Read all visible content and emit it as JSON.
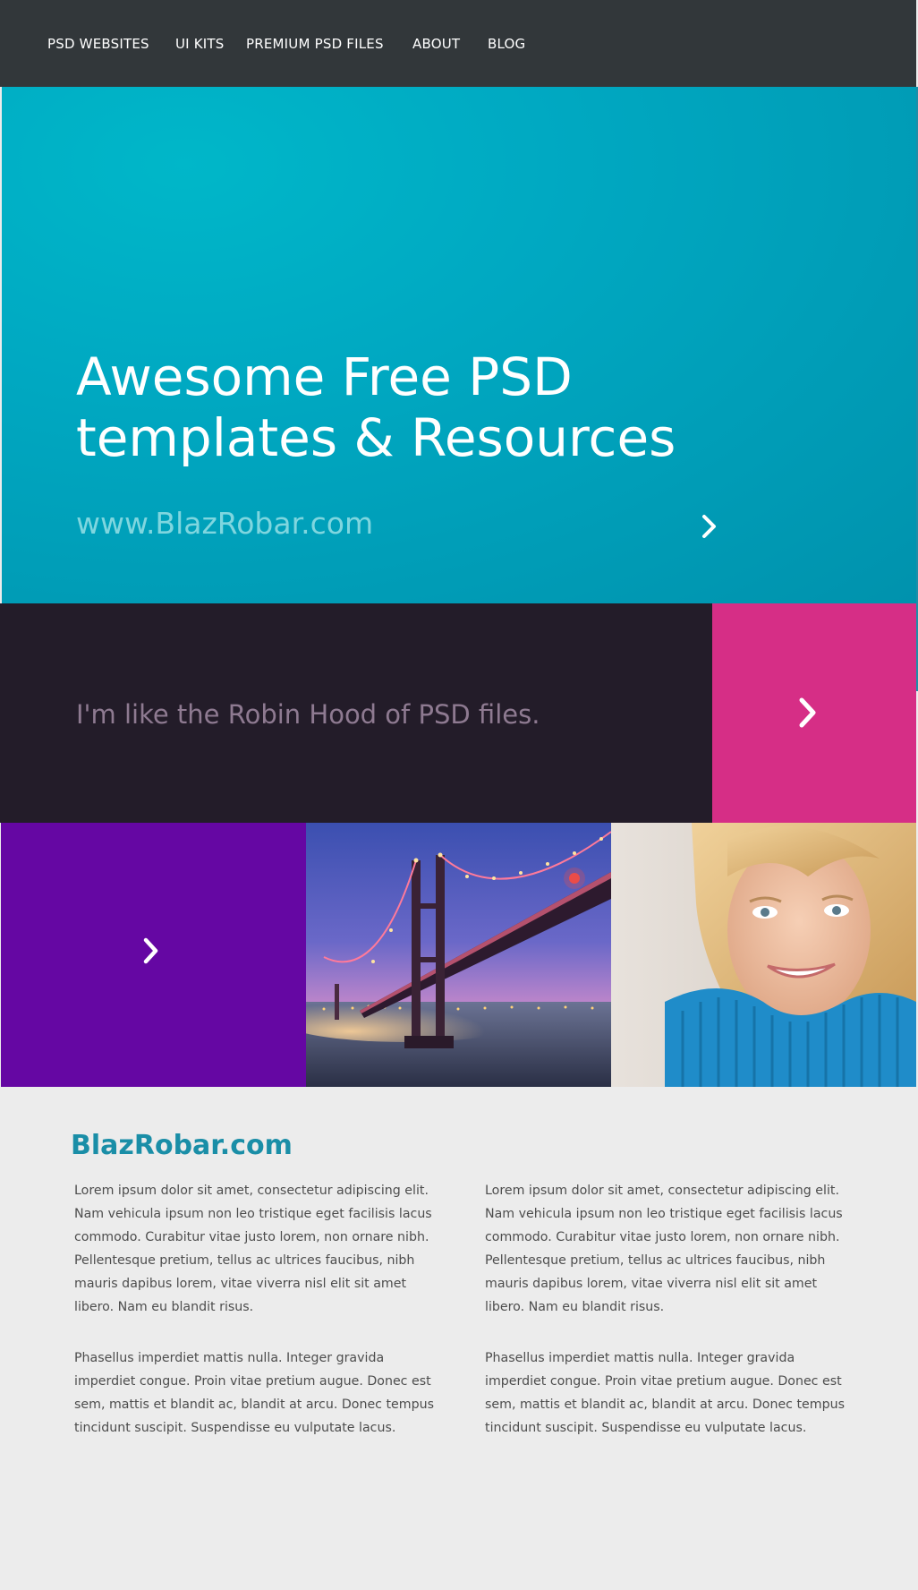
{
  "nav": {
    "items": [
      {
        "label": "PSD WEBSITES"
      },
      {
        "label": "UI KITS"
      },
      {
        "label": "PREMIUM PSD FILES"
      },
      {
        "label": "ABOUT"
      },
      {
        "label": "BLOG"
      }
    ]
  },
  "hero": {
    "title_line1": "Awesome Free PSD",
    "title_line2": "templates & Resources",
    "url": "www.BlazRobar.com",
    "arrow_icon": "chevron-right-icon"
  },
  "band": {
    "text": "I'm like the Robin Hood of PSD files.",
    "arrow_icon": "chevron-right-icon"
  },
  "tiles": {
    "purple_arrow_icon": "chevron-right-icon",
    "bridge_image": "bridge-photo",
    "woman_image": "woman-portrait-photo"
  },
  "content": {
    "title": "BlazRobar.com",
    "left": {
      "p1": "Lorem ipsum dolor sit amet, consectetur adipiscing elit. Nam vehicula ipsum non leo tristique eget facilisis lacus commodo. Curabitur vitae justo lorem, non ornare nibh. Pellentesque pretium, tellus ac ultrices faucibus, nibh mauris dapibus lorem, vitae viverra nisl elit sit amet libero. Nam eu blandit risus.",
      "p2": "Phasellus imperdiet mattis nulla. Integer gravida imperdiet congue. Proin vitae pretium augue. Donec est sem, mattis et blandit ac, blandit at arcu. Donec tempus tincidunt suscipit. Suspendisse eu vulputate lacus."
    },
    "right": {
      "p1": "Lorem ipsum dolor sit amet, consectetur adipiscing elit. Nam vehicula ipsum non leo tristique eget facilisis lacus commodo. Curabitur vitae justo lorem, non ornare nibh. Pellentesque pretium, tellus ac ultrices faucibus, nibh mauris dapibus lorem, vitae viverra nisl elit sit amet libero. Nam eu blandit risus.",
      "p2": "Phasellus imperdiet mattis nulla. Integer gravida imperdiet congue. Proin vitae pretium augue. Donec est sem, mattis et blandit ac, blandit at arcu. Donec tempus tincidunt suscipit. Suspendisse eu vulputate lacus."
    }
  },
  "colors": {
    "nav_bg": "#32373a",
    "hero_bg": "#00a9c2",
    "band_bg": "#231c29",
    "pink": "#d62e86",
    "purple": "#6507a3",
    "content_bg": "#ececec",
    "accent_text": "#1a8ea7"
  }
}
